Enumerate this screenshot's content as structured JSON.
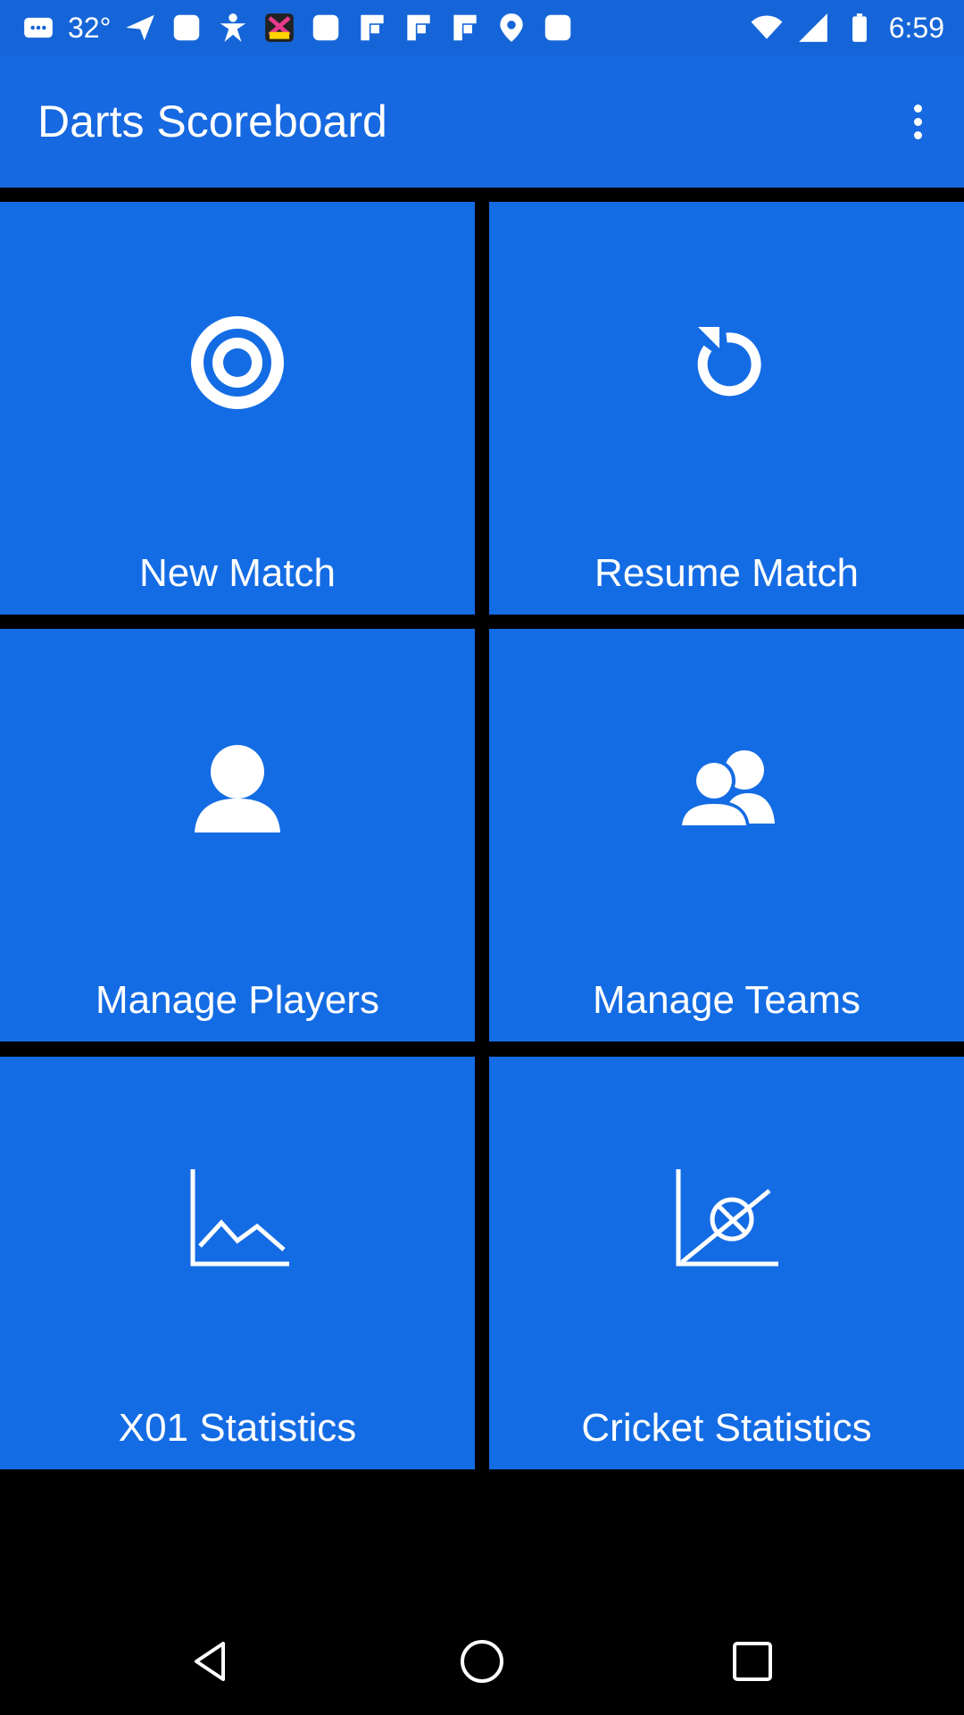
{
  "status_bar": {
    "temperature": "32°",
    "time": "6:59",
    "notification_icons": [
      "messages-icon",
      "send-icon",
      "calendar-icon",
      "figure-icon",
      "pop-app-icon",
      "square-icon",
      "flipboard-icon",
      "flipboard-icon",
      "flipboard-icon",
      "location-icon",
      "square-icon"
    ]
  },
  "app_bar": {
    "title": "Darts Scoreboard",
    "menu_icon": "more-vert-icon"
  },
  "tiles": [
    {
      "label": "New Match",
      "icon": "target-icon"
    },
    {
      "label": "Resume Match",
      "icon": "refresh-icon"
    },
    {
      "label": "Manage Players",
      "icon": "person-icon"
    },
    {
      "label": "Manage Teams",
      "icon": "people-icon"
    },
    {
      "label": "X01 Statistics",
      "icon": "line-chart-icon"
    },
    {
      "label": "Cricket Statistics",
      "icon": "scatter-chart-icon"
    }
  ],
  "nav_bar": {
    "icons": [
      "back-icon",
      "home-icon",
      "recents-icon"
    ]
  },
  "colors": {
    "status_bar": "#1565d8",
    "app_bar": "#1669e0",
    "tile": "#146ce4",
    "background": "#000000"
  }
}
